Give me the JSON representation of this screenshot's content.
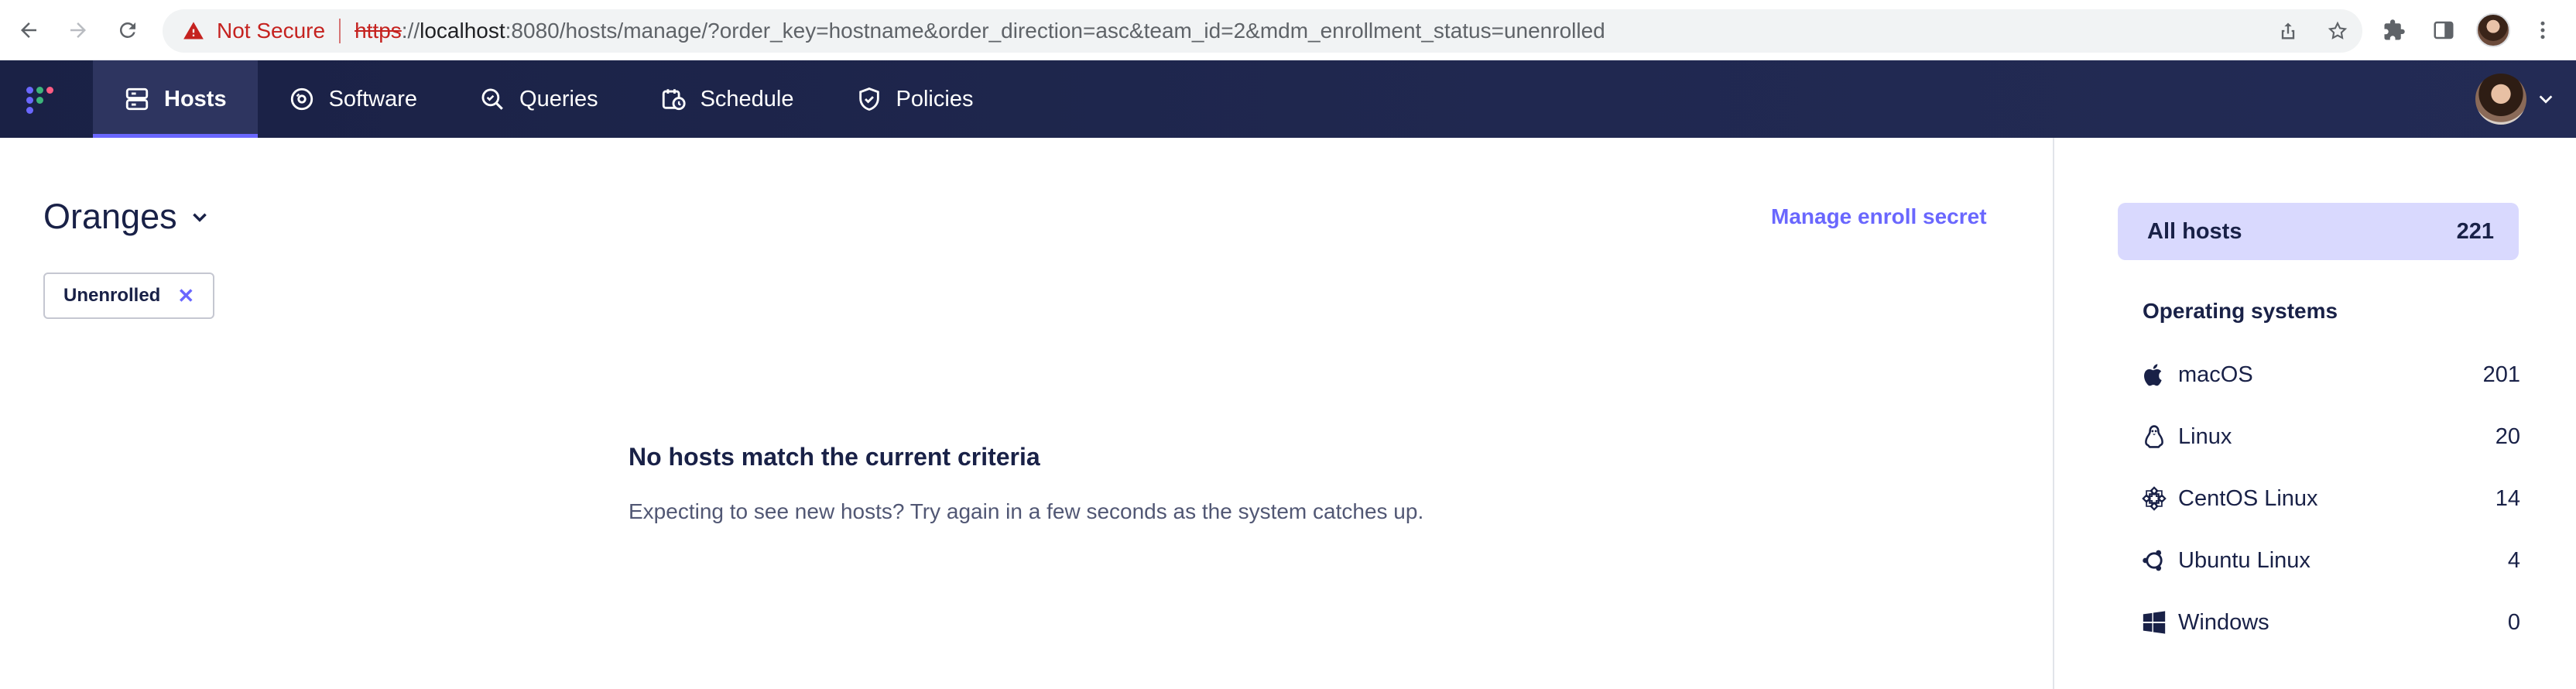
{
  "browser": {
    "security_label": "Not Secure",
    "url_scheme": "https",
    "url_sep": "://",
    "url_host": "localhost",
    "url_rest": ":8080/hosts/manage/?order_key=hostname&order_direction=asc&team_id=2&mdm_enrollment_status=unenrolled"
  },
  "nav": {
    "tabs": [
      {
        "label": "Hosts",
        "icon": "server-icon",
        "active": true
      },
      {
        "label": "Software",
        "icon": "disc-icon"
      },
      {
        "label": "Queries",
        "icon": "search-check-icon"
      },
      {
        "label": "Schedule",
        "icon": "calendar-clock-icon"
      },
      {
        "label": "Policies",
        "icon": "shield-check-icon"
      }
    ]
  },
  "main": {
    "team_name": "Oranges",
    "manage_link": "Manage enroll secret",
    "filter_pill": "Unenrolled",
    "filter_pill_close": "✕",
    "empty_title": "No hosts match the current criteria",
    "empty_desc": "Expecting to see new hosts? Try again in a few seconds as the system catches up."
  },
  "sidebar": {
    "all_hosts_label": "All hosts",
    "all_hosts_count": "221",
    "os_heading": "Operating systems",
    "os_items": [
      {
        "label": "macOS",
        "count": "201",
        "icon": "apple-icon"
      },
      {
        "label": "Linux",
        "count": "20",
        "icon": "linux-icon"
      },
      {
        "label": "CentOS Linux",
        "count": "14",
        "icon": "centos-icon"
      },
      {
        "label": "Ubuntu Linux",
        "count": "4",
        "icon": "ubuntu-icon"
      },
      {
        "label": "Windows",
        "count": "0",
        "icon": "windows-icon"
      }
    ]
  },
  "colors": {
    "nav_bg": "#1a2145",
    "accent": "#6a67fe",
    "all_hosts_bg": "#d9d9fe",
    "text_primary": "#192147",
    "warning_red": "#c5221f"
  }
}
